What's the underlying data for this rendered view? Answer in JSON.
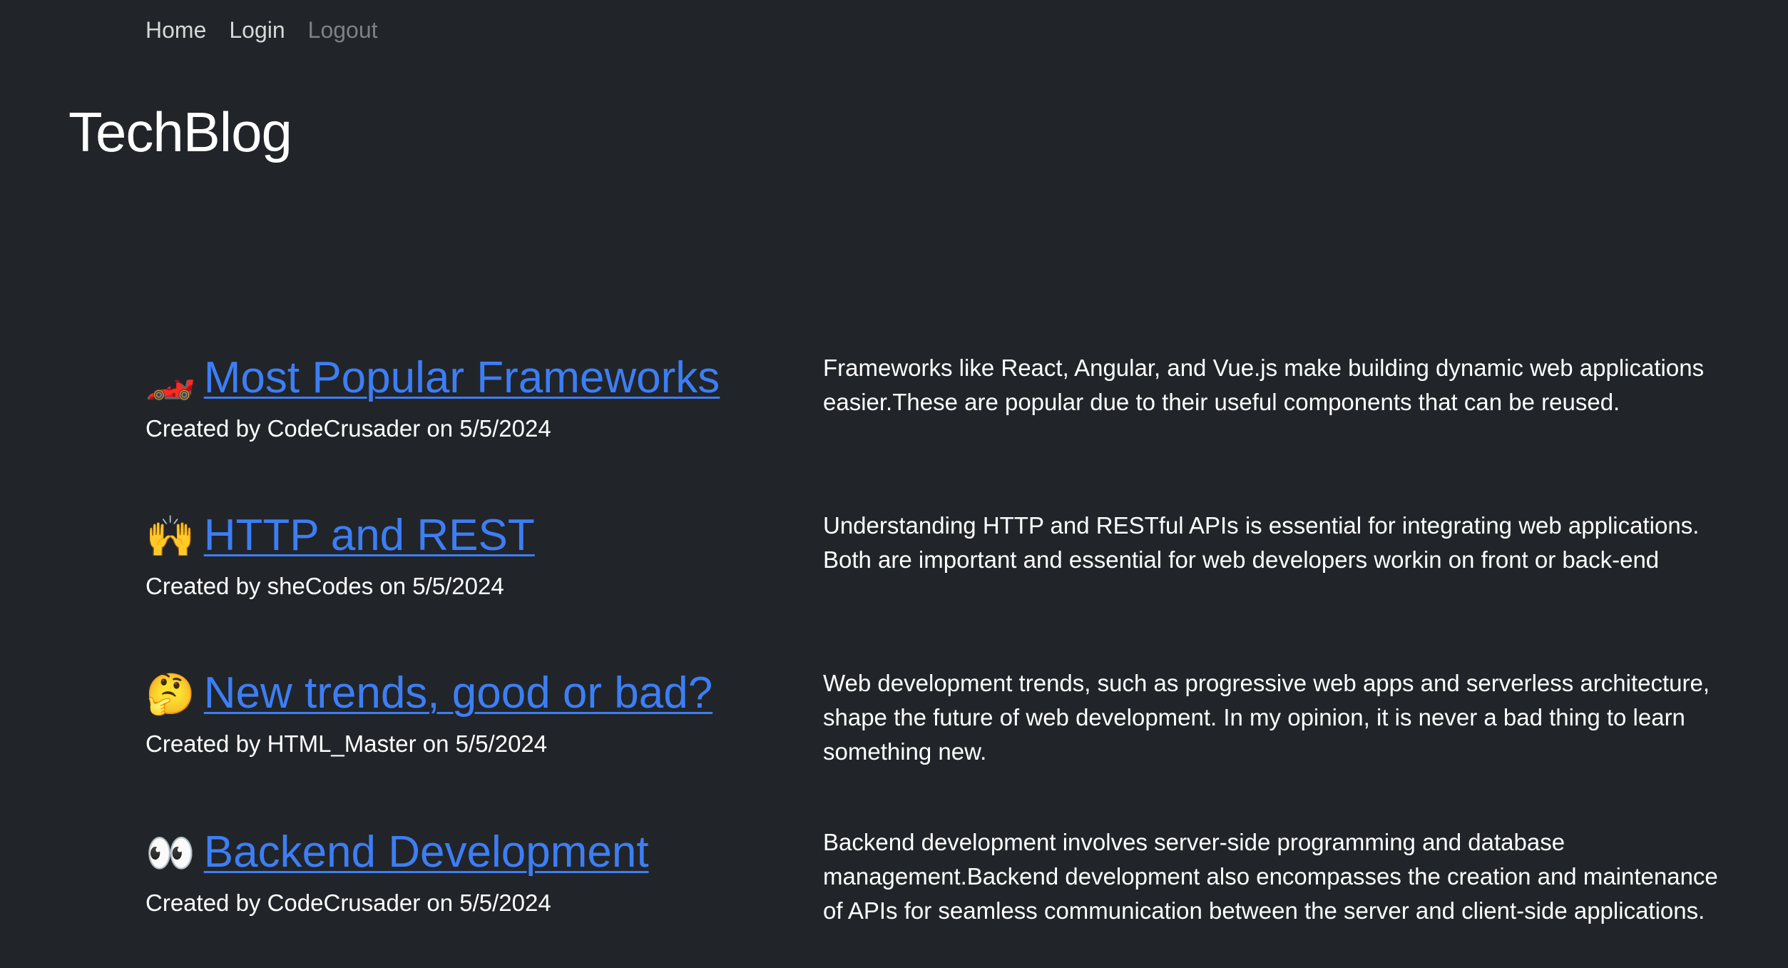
{
  "nav": {
    "home": "Home",
    "login": "Login",
    "logout": "Logout"
  },
  "brand": "TechBlog",
  "posts": [
    {
      "emoji": "🏎️",
      "title": "Most Popular Frameworks",
      "meta": "Created by CodeCrusader on 5/5/2024",
      "body": "Frameworks like React, Angular, and Vue.js make building dynamic web applications easier.These are popular due to their useful components that can be reused."
    },
    {
      "emoji": "🙌",
      "title": "HTTP and REST",
      "meta": "Created by sheCodes on 5/5/2024",
      "body": "Understanding HTTP and RESTful APIs is essential for integrating web applications. Both are important and essential for web developers workin on front or back-end"
    },
    {
      "emoji": "🤔",
      "title": "New trends, good or bad?",
      "meta": "Created by HTML_Master on 5/5/2024",
      "body": "Web development trends, such as progressive web apps and serverless architecture, shape the future of web development. In my opinion, it is never a bad thing to learn something new."
    },
    {
      "emoji": "👀",
      "title": "Backend Development",
      "meta": "Created by CodeCrusader on 5/5/2024",
      "body": "Backend development involves server-side programming and database management.Backend development also encompasses the creation and maintenance of APIs for seamless communication between the server and client-side applications."
    }
  ]
}
